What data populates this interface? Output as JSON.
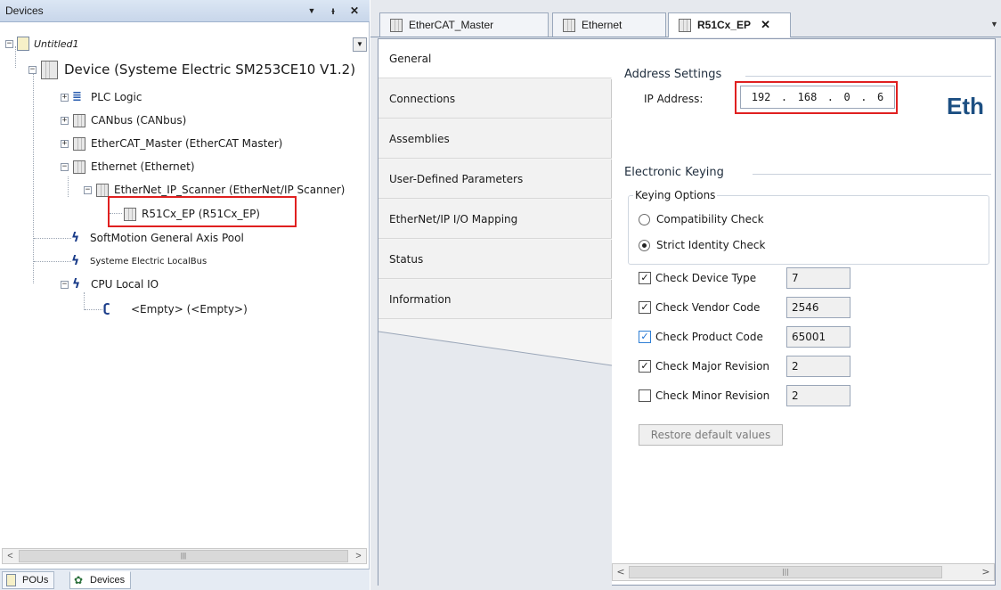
{
  "devices_panel": {
    "title": "Devices",
    "buttons": {
      "menu": "▼",
      "pin": "ᵼ",
      "close": "✕"
    },
    "tree": {
      "project": "Untitled1",
      "device": "Device (Systeme Electric SM253CE10 V1.2)",
      "plc_logic": "PLC Logic",
      "canbus": "CANbus (CANbus)",
      "ethercat": "EtherCAT_Master (EtherCAT Master)",
      "ethernet": "Ethernet (Ethernet)",
      "scanner": "EtherNet_IP_Scanner (EtherNet/IP Scanner)",
      "r51": "R51Cx_EP (R51Cx_EP)",
      "softmotion": "SoftMotion General Axis Pool",
      "localbus": "Systeme Electric LocalBus",
      "cpu_io": "CPU Local IO",
      "empty": "<Empty> (<Empty>)"
    },
    "bottom_tabs": {
      "pous": "POUs",
      "devices": "Devices"
    }
  },
  "editor_tabs": [
    {
      "label": "EtherCAT_Master"
    },
    {
      "label": "Ethernet"
    },
    {
      "label": "R51Cx_EP",
      "close": "✕"
    }
  ],
  "side_tabs": [
    "General",
    "Connections",
    "Assemblies",
    "User-Defined Parameters",
    "EtherNet/IP I/O Mapping",
    "Status",
    "Information"
  ],
  "general": {
    "address_settings_title": "Address Settings",
    "ip_label": "IP Address:",
    "ip": [
      "192",
      "168",
      "0",
      "6"
    ],
    "ip_dots": ".",
    "logo_text": "Eth",
    "electronic_keying_title": "Electronic Keying",
    "keying_options_legend": "Keying Options",
    "radio_compat": "Compatibility Check",
    "radio_strict": "Strict Identity Check",
    "selected_radio": "strict",
    "checks": [
      {
        "label": "Check Device Type",
        "checked": true,
        "value": "7"
      },
      {
        "label": "Check Vendor Code",
        "checked": true,
        "value": "2546"
      },
      {
        "label": "Check Product Code",
        "checked": true,
        "value": "65001"
      },
      {
        "label": "Check Major Revision",
        "checked": true,
        "value": "2"
      },
      {
        "label": "Check Minor Revision",
        "checked": false,
        "value": "2"
      }
    ],
    "restore_button": "Restore default values"
  },
  "colors": {
    "highlight_box": "#e02020",
    "logo": "#1c4f82",
    "header_bg": "#c8d6ea"
  }
}
